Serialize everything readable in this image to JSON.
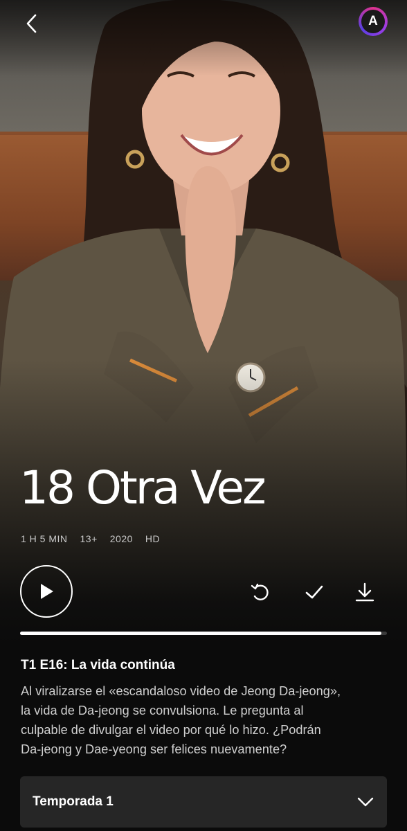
{
  "show": {
    "title": "18 Otra Vez",
    "meta": [
      "1 H 5 MIN",
      "13+",
      "2020",
      "HD"
    ]
  },
  "header": {
    "back_icon": "chevron-left-icon",
    "avatar_letter": "A",
    "avatar_colors": [
      "#e0338f",
      "#9a3de6",
      "#5b3fe0"
    ]
  },
  "actions": {
    "play_icon": "play-icon",
    "restart_icon": "restart-icon",
    "mylist_icon": "check-icon",
    "download_icon": "download-icon"
  },
  "progress": {
    "fraction": 0.985
  },
  "episode": {
    "title": "T1 E16: La vida continúa",
    "lines": [
      "Al viralizarse el «escandaloso video de Jeong Da-jeong»,",
      "la vida de Da-jeong se convulsiona. Le pregunta al",
      "culpable de divulgar el video por qué lo hizo. ¿Podrán",
      "Da-jeong y Dae-yeong ser felices nuevamente?"
    ]
  },
  "season_selector": {
    "label": "Temporada 1",
    "icon": "chevron-down-icon"
  },
  "colors": {
    "background": "#0b0b0b",
    "progress_fill": "#ffffff",
    "progress_track": "#3a3a3a",
    "season_bg": "#262626"
  }
}
